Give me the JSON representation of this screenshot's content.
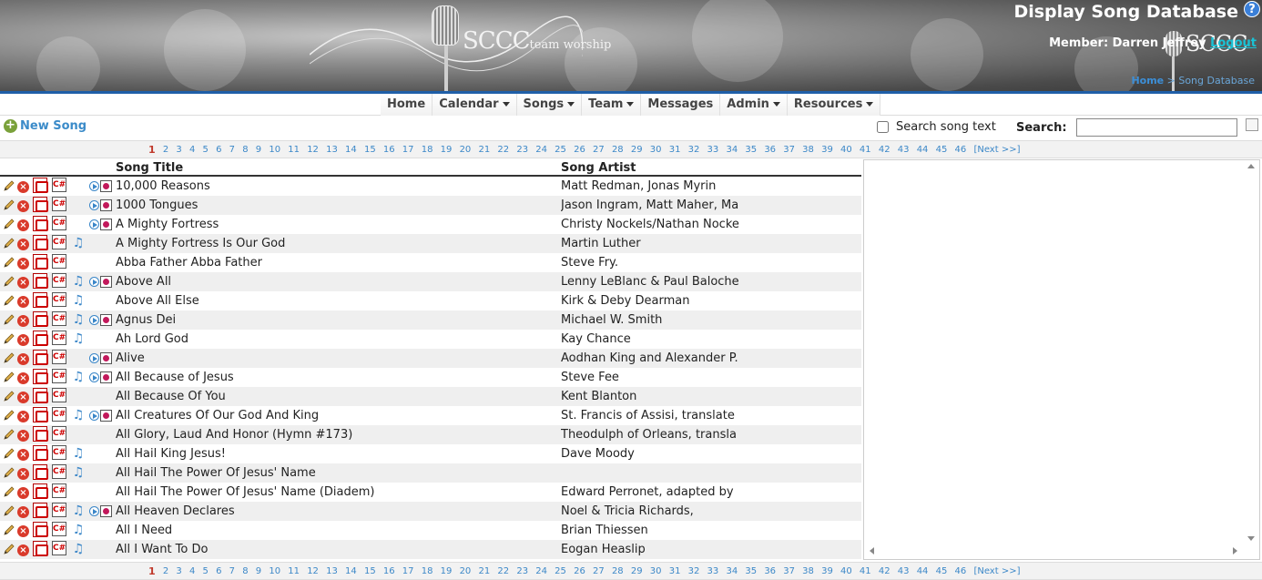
{
  "header": {
    "title": "Display Song Database",
    "help": "?",
    "member_label": "Member: Darren Jeffrey",
    "logout": "Logout",
    "logo_text": "SCCC",
    "logo_sub": "team worship",
    "breadcrumb_home": "Home",
    "breadcrumb_sep": ">",
    "breadcrumb_current": "Song Database"
  },
  "nav": {
    "items": [
      {
        "label": "Home",
        "dropdown": false
      },
      {
        "label": "Calendar",
        "dropdown": true
      },
      {
        "label": "Songs",
        "dropdown": true
      },
      {
        "label": "Team",
        "dropdown": true
      },
      {
        "label": "Messages",
        "dropdown": false
      },
      {
        "label": "Admin",
        "dropdown": true
      },
      {
        "label": "Resources",
        "dropdown": true
      }
    ]
  },
  "toolbar": {
    "new_song": "New Song",
    "search_song_text": "Search song text",
    "search_label": "Search:",
    "search_value": ""
  },
  "pagination": {
    "current": "1",
    "pages": [
      "1",
      "2",
      "3",
      "4",
      "5",
      "6",
      "7",
      "8",
      "9",
      "10",
      "11",
      "12",
      "13",
      "14",
      "15",
      "16",
      "17",
      "18",
      "19",
      "20",
      "21",
      "22",
      "23",
      "24",
      "25",
      "26",
      "27",
      "28",
      "29",
      "30",
      "31",
      "32",
      "33",
      "34",
      "35",
      "36",
      "37",
      "38",
      "39",
      "40",
      "41",
      "42",
      "43",
      "44",
      "45",
      "46"
    ],
    "next": "[Next >>]"
  },
  "table": {
    "col_title": "Song Title",
    "col_artist": "Song Artist",
    "rows": [
      {
        "title": "10,000 Reasons",
        "artist": "Matt Redman, Jonas Myrin",
        "music": false,
        "play": true
      },
      {
        "title": "1000 Tongues",
        "artist": "Jason Ingram, Matt Maher, Ma",
        "music": false,
        "play": true
      },
      {
        "title": "A Mighty Fortress",
        "artist": "Christy Nockels/Nathan Nocke",
        "music": false,
        "play": true
      },
      {
        "title": "A Mighty Fortress Is Our God",
        "artist": "Martin Luther",
        "music": true,
        "play": false
      },
      {
        "title": "Abba Father Abba Father",
        "artist": "Steve Fry.",
        "music": false,
        "play": false
      },
      {
        "title": "Above All",
        "artist": "Lenny LeBlanc & Paul Baloche",
        "music": true,
        "play": true
      },
      {
        "title": "Above All Else",
        "artist": "Kirk & Deby Dearman",
        "music": true,
        "play": false
      },
      {
        "title": "Agnus Dei",
        "artist": "Michael W. Smith",
        "music": true,
        "play": true
      },
      {
        "title": "Ah Lord God",
        "artist": "Kay Chance",
        "music": true,
        "play": false
      },
      {
        "title": "Alive",
        "artist": "Aodhan King and Alexander P.",
        "music": false,
        "play": true
      },
      {
        "title": "All Because of Jesus",
        "artist": "Steve Fee",
        "music": true,
        "play": true
      },
      {
        "title": "All Because Of You",
        "artist": "Kent Blanton",
        "music": false,
        "play": false
      },
      {
        "title": "All Creatures Of Our God And King",
        "artist": "St. Francis of Assisi, translate",
        "music": true,
        "play": true
      },
      {
        "title": "All Glory, Laud And Honor (Hymn #173)",
        "artist": "Theodulph of Orleans, transla",
        "music": false,
        "play": false
      },
      {
        "title": "All Hail King Jesus!",
        "artist": "Dave Moody",
        "music": true,
        "play": false
      },
      {
        "title": "All Hail The Power Of Jesus' Name",
        "artist": "",
        "music": true,
        "play": false
      },
      {
        "title": "All Hail The Power Of Jesus' Name (Diadem)",
        "artist": "Edward Perronet, adapted by",
        "music": false,
        "play": false
      },
      {
        "title": "All Heaven Declares",
        "artist": "Noel & Tricia Richards,",
        "music": true,
        "play": true
      },
      {
        "title": "All I Need",
        "artist": "Brian Thiessen",
        "music": true,
        "play": false
      },
      {
        "title": "All I Want To Do",
        "artist": "Eogan Heaslip",
        "music": true,
        "play": false
      }
    ]
  }
}
